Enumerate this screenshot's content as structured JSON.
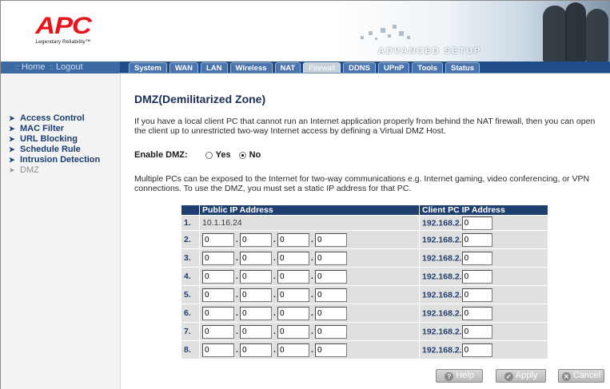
{
  "header": {
    "logo_text": "APC",
    "logo_tagline": "Legendary Reliability™",
    "banner_title": "ADVANCED SETUP"
  },
  "topnav": {
    "home": "Home",
    "logout": "Logout"
  },
  "tabs": [
    {
      "label": "System"
    },
    {
      "label": "WAN"
    },
    {
      "label": "LAN"
    },
    {
      "label": "Wireless"
    },
    {
      "label": "NAT"
    },
    {
      "label": "Firewall",
      "active": true
    },
    {
      "label": "DDNS"
    },
    {
      "label": "UPnP"
    },
    {
      "label": "Tools"
    },
    {
      "label": "Status"
    }
  ],
  "sidebar": {
    "items": [
      {
        "label": "Access Control"
      },
      {
        "label": "MAC Filter"
      },
      {
        "label": "URL Blocking"
      },
      {
        "label": "Schedule Rule"
      },
      {
        "label": "Intrusion Detection"
      },
      {
        "label": "DMZ",
        "current": true
      }
    ]
  },
  "main": {
    "title": "DMZ(Demilitarized Zone)",
    "intro": "If you have a local client PC that cannot run an Internet application properly from behind the NAT firewall, then you can open the client up to unrestricted two-way Internet access by defining a Virtual DMZ Host.",
    "enable_label": "Enable DMZ:",
    "enable_yes": "Yes",
    "enable_no": "No",
    "enable_value": "No",
    "note": "Multiple PCs can be exposed to the Internet for two-way communications e.g. Internet gaming, video conferencing, or VPN connections.  To use the DMZ, you must set a static IP address for that PC."
  },
  "table": {
    "col_public": "Public IP Address",
    "col_client": "Client PC IP Address",
    "client_prefix": "192.168.2.",
    "rows": [
      {
        "num": "1.",
        "public": "10.1.16.24",
        "client": "0"
      },
      {
        "num": "2.",
        "public_octets": [
          "0",
          "0",
          "0",
          "0"
        ],
        "client": "0"
      },
      {
        "num": "3.",
        "public_octets": [
          "0",
          "0",
          "0",
          "0"
        ],
        "client": "0"
      },
      {
        "num": "4.",
        "public_octets": [
          "0",
          "0",
          "0",
          "0"
        ],
        "client": "0"
      },
      {
        "num": "5.",
        "public_octets": [
          "0",
          "0",
          "0",
          "0"
        ],
        "client": "0"
      },
      {
        "num": "6.",
        "public_octets": [
          "0",
          "0",
          "0",
          "0"
        ],
        "client": "0"
      },
      {
        "num": "7.",
        "public_octets": [
          "0",
          "0",
          "0",
          "0"
        ],
        "client": "0"
      },
      {
        "num": "8.",
        "public_octets": [
          "0",
          "0",
          "0",
          "0"
        ],
        "client": "0"
      }
    ]
  },
  "buttons": {
    "help": "Help",
    "apply": "Apply",
    "cancel": "Cancel"
  },
  "colors": {
    "nav_blue": "#1f4d8a",
    "table_header": "#1f3f70",
    "brand_red": "#e8131b"
  }
}
